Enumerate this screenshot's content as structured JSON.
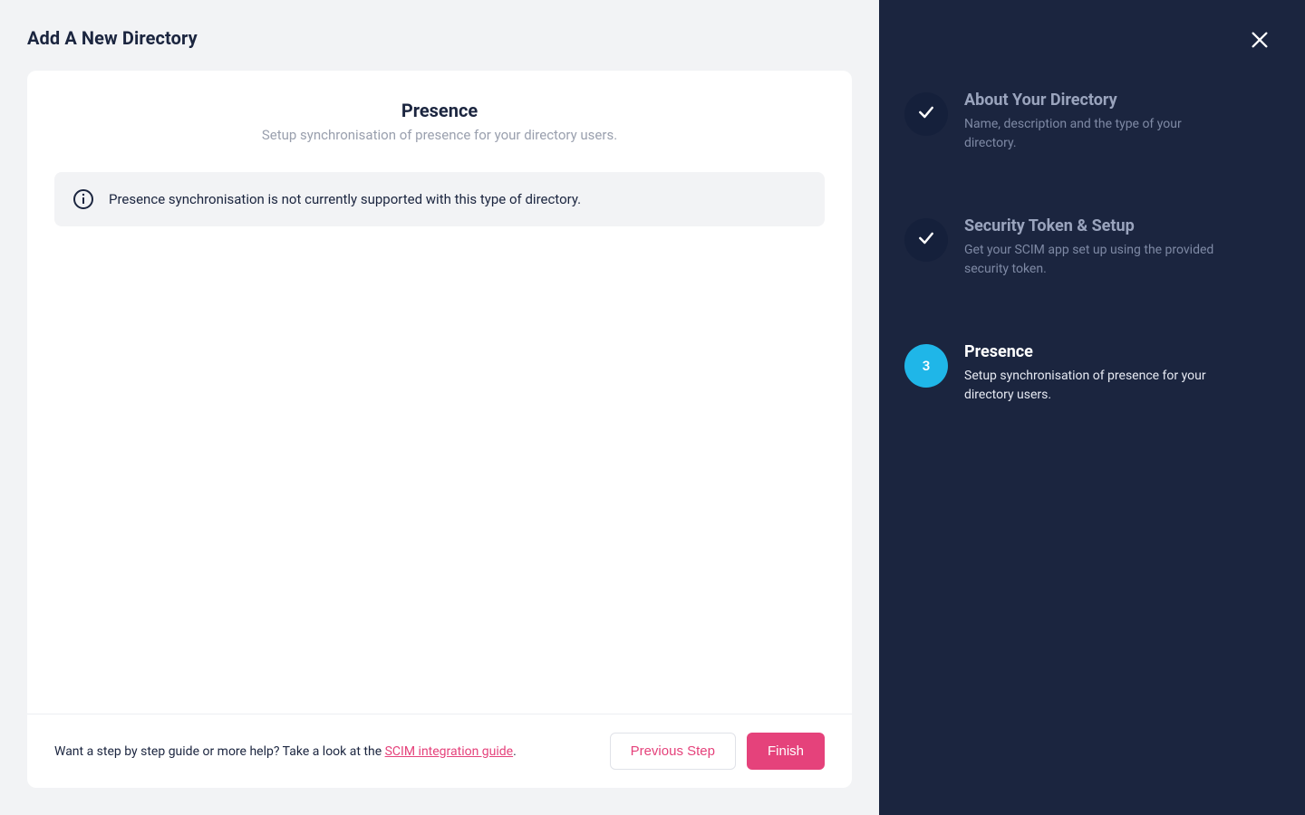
{
  "colors": {
    "accent_pink": "#e5427b",
    "accent_blue": "#1fb6e8",
    "sidebar_bg": "#1b253f"
  },
  "header": {
    "title": "Add A New Directory"
  },
  "main": {
    "title": "Presence",
    "subtitle": "Setup synchronisation of presence for your directory users.",
    "notice": "Presence synchronisation is not currently supported with this type of directory."
  },
  "footer": {
    "help_prefix": "Want a step by step guide or more help? Take a look at the ",
    "help_link": "SCIM integration guide",
    "help_suffix": ".",
    "previous": "Previous Step",
    "finish": "Finish"
  },
  "sidebar": {
    "steps": [
      {
        "status": "done",
        "marker": "",
        "title": "About Your Directory",
        "desc": "Name, description and the type of your directory."
      },
      {
        "status": "done",
        "marker": "",
        "title": "Security Token & Setup",
        "desc": "Get your SCIM app set up using the provided security token."
      },
      {
        "status": "active",
        "marker": "3",
        "title": "Presence",
        "desc": "Setup synchronisation of presence for your directory users."
      }
    ]
  }
}
